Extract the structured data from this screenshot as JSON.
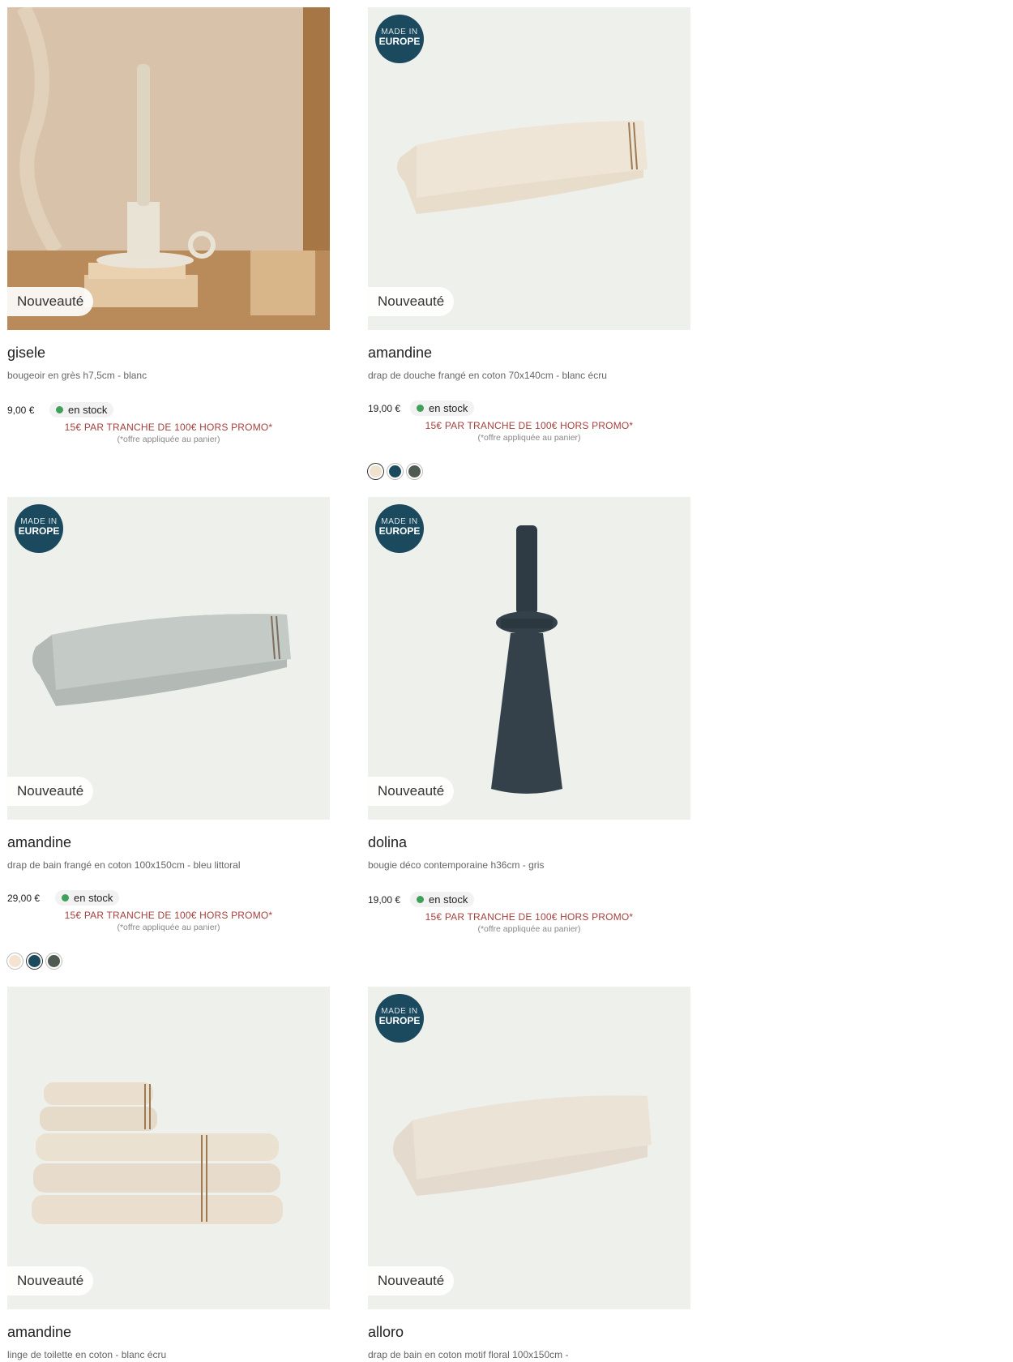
{
  "labels": {
    "new_badge": "Nouveauté",
    "made_in_top": "MADE IN",
    "made_in_bottom": "EUROPE",
    "in_stock": "en stock"
  },
  "promo": {
    "text": "15€ PAR TRANCHE DE 100€ HORS PROMO*",
    "note": "(*offre appliquée au panier)"
  },
  "products": [
    {
      "name": "gisele",
      "desc": "bougeoir en grès h7,5cm - blanc",
      "price": "9,00 €"
    },
    {
      "name": "amandine",
      "desc": "drap de douche frangé en coton 70x140cm - blanc écru",
      "price": "19,00 €",
      "swatch_colors": [
        "#efe3d0",
        "#1b4a5e",
        "#4f5a52"
      ]
    },
    {
      "name": "amandine",
      "desc": "drap de bain frangé en coton 100x150cm - bleu littoral",
      "price": "29,00 €",
      "swatch_colors": [
        "#f4e4cf",
        "#1b4a5e",
        "#4f5a52"
      ]
    },
    {
      "name": "dolina",
      "desc": "bougie déco contemporaine h36cm - gris",
      "price": "19,00 €"
    },
    {
      "name": "amandine",
      "desc": "linge de toilette en coton - blanc écru"
    },
    {
      "name": "alloro",
      "desc": "drap de bain en coton motif floral 100x150cm -"
    }
  ],
  "colors": {
    "promo": "#a5413e",
    "stock_dot": "#3fa05a",
    "made_in_bg": "#1b4a5e",
    "image_bg": "#eef0ec"
  }
}
